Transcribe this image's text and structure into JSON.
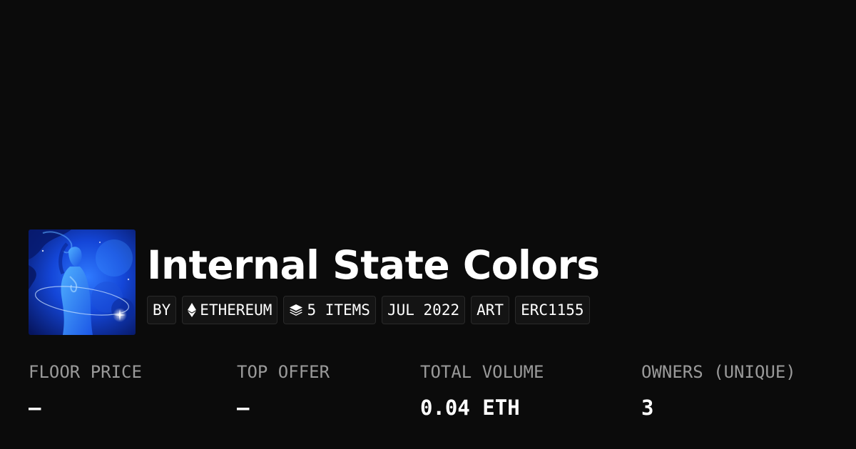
{
  "collection": {
    "title": "Internal State Colors",
    "image_alt": "collection artwork of a blue figure"
  },
  "badges": {
    "by": "BY",
    "chain": {
      "label": "ETHEREUM",
      "icon": "ethereum-icon"
    },
    "items": {
      "label": "5 ITEMS",
      "icon": "layers-icon"
    },
    "date": "JUL 2022",
    "category": "ART",
    "standard": "ERC1155"
  },
  "stats": [
    {
      "label": "FLOOR PRICE",
      "value": "–"
    },
    {
      "label": "TOP OFFER",
      "value": "–"
    },
    {
      "label": "TOTAL VOLUME",
      "value": "0.04 ETH"
    },
    {
      "label": "OWNERS (UNIQUE)",
      "value": "3"
    }
  ],
  "colors": {
    "background": "#0b0b0b",
    "badge_background": "#141414",
    "label_gray": "#9a9a9a",
    "text_white": "#ffffff",
    "artwork_blue": "#1a5cff"
  }
}
